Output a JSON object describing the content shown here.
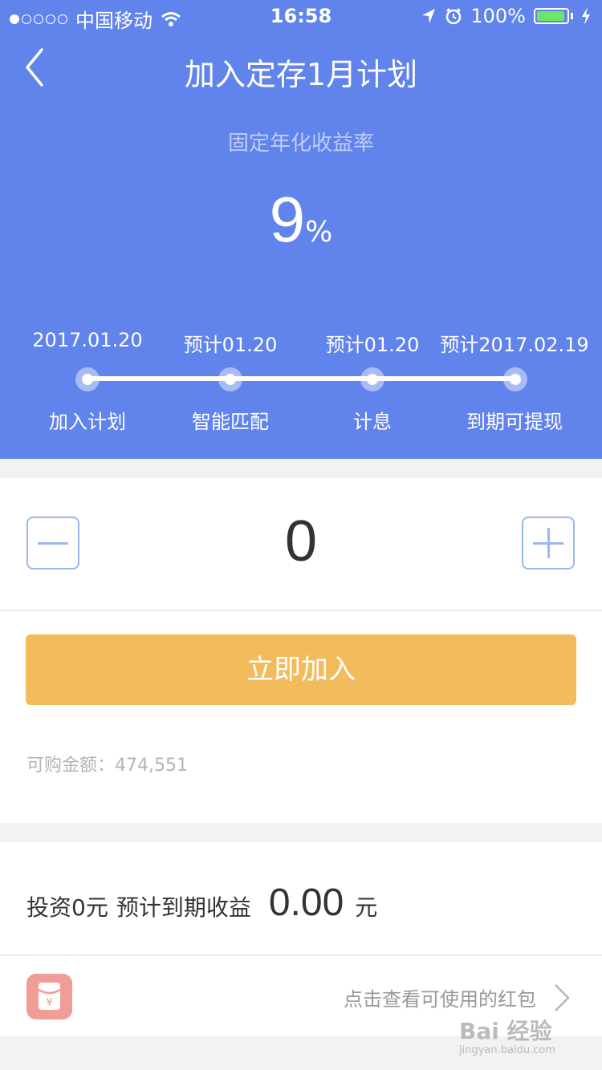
{
  "status_bar": {
    "carrier": "中国移动",
    "time": "16:58",
    "battery": "100%",
    "battery_color": "#6de36a",
    "signal_bars_filled": 1,
    "signal_bars_total": 5
  },
  "nav": {
    "title": "加入定存1月计划",
    "back_icon": "chevron-left-icon"
  },
  "hero": {
    "background": "#6183ec",
    "rate_label": "固定年化收益率",
    "rate_value": "9",
    "rate_unit": "%"
  },
  "timeline": {
    "steps": [
      {
        "date": "2017.01.20",
        "name": "加入计划"
      },
      {
        "date": "预计01.20",
        "name": "智能匹配"
      },
      {
        "date": "预计01.20",
        "name": "计息"
      },
      {
        "date": "预计2017.02.19",
        "name": "到期可提现"
      }
    ]
  },
  "purchase": {
    "amount": "0",
    "minus_icon": "minus-icon",
    "plus_icon": "plus-icon",
    "join_label": "立即加入",
    "join_color": "#f2bb5c",
    "available_label": "可购金额：",
    "available_value": "474,551"
  },
  "returns": {
    "invest_text": "投资0元",
    "expected_label": "预计到期收益",
    "expected_value": "0.00",
    "unit": "元"
  },
  "red_packet": {
    "icon": "red-packet-icon",
    "text": "点击查看可使用的红包",
    "chevron_icon": "chevron-right-icon",
    "icon_glyph": "¥"
  },
  "watermark": {
    "logo": "Bai 经验",
    "url": "jingyan.baidu.com"
  }
}
